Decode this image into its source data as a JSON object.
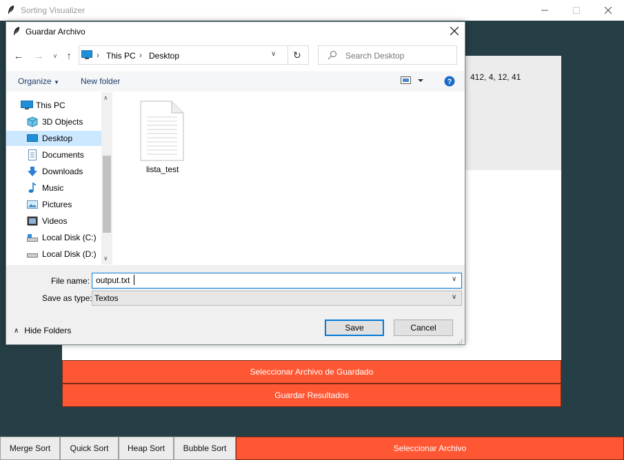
{
  "app": {
    "title": "Sorting Visualizer",
    "list_preview": "412, 4, 12, 41",
    "select_save_file_label": "Seleccionar Archivo de Guardado",
    "save_results_label": "Guardar Resultados",
    "algorithms": [
      "Merge Sort",
      "Quick Sort",
      "Heap Sort",
      "Bubble Sort"
    ],
    "select_file_label": "Seleccionar Archivo"
  },
  "dialog": {
    "title": "Guardar Archivo",
    "breadcrumb": [
      "This PC",
      "Desktop"
    ],
    "search_placeholder": "Search Desktop",
    "organize_label": "Organize",
    "new_folder_label": "New folder",
    "nav_items": [
      {
        "label": "This PC",
        "icon": "computer-icon"
      },
      {
        "label": "3D Objects",
        "icon": "cube-icon"
      },
      {
        "label": "Desktop",
        "icon": "desktop-icon",
        "selected": true
      },
      {
        "label": "Documents",
        "icon": "documents-icon"
      },
      {
        "label": "Downloads",
        "icon": "download-icon"
      },
      {
        "label": "Music",
        "icon": "music-icon"
      },
      {
        "label": "Pictures",
        "icon": "pictures-icon"
      },
      {
        "label": "Videos",
        "icon": "videos-icon"
      },
      {
        "label": "Local Disk (C:)",
        "icon": "disk-icon"
      },
      {
        "label": "Local Disk (D:)",
        "icon": "disk-icon"
      }
    ],
    "files": [
      {
        "name": "lista_test",
        "icon": "text-file-icon"
      }
    ],
    "file_name_label": "File name:",
    "file_name_value": "output.txt",
    "save_as_type_label": "Save as type:",
    "save_as_type_value": "Textos",
    "save_label": "Save",
    "cancel_label": "Cancel",
    "hide_folders_label": "Hide Folders"
  },
  "colors": {
    "app_background": "#263e45",
    "accent_orange": "#ff5733",
    "selection": "#cce8ff",
    "focus_blue": "#0078d7"
  }
}
